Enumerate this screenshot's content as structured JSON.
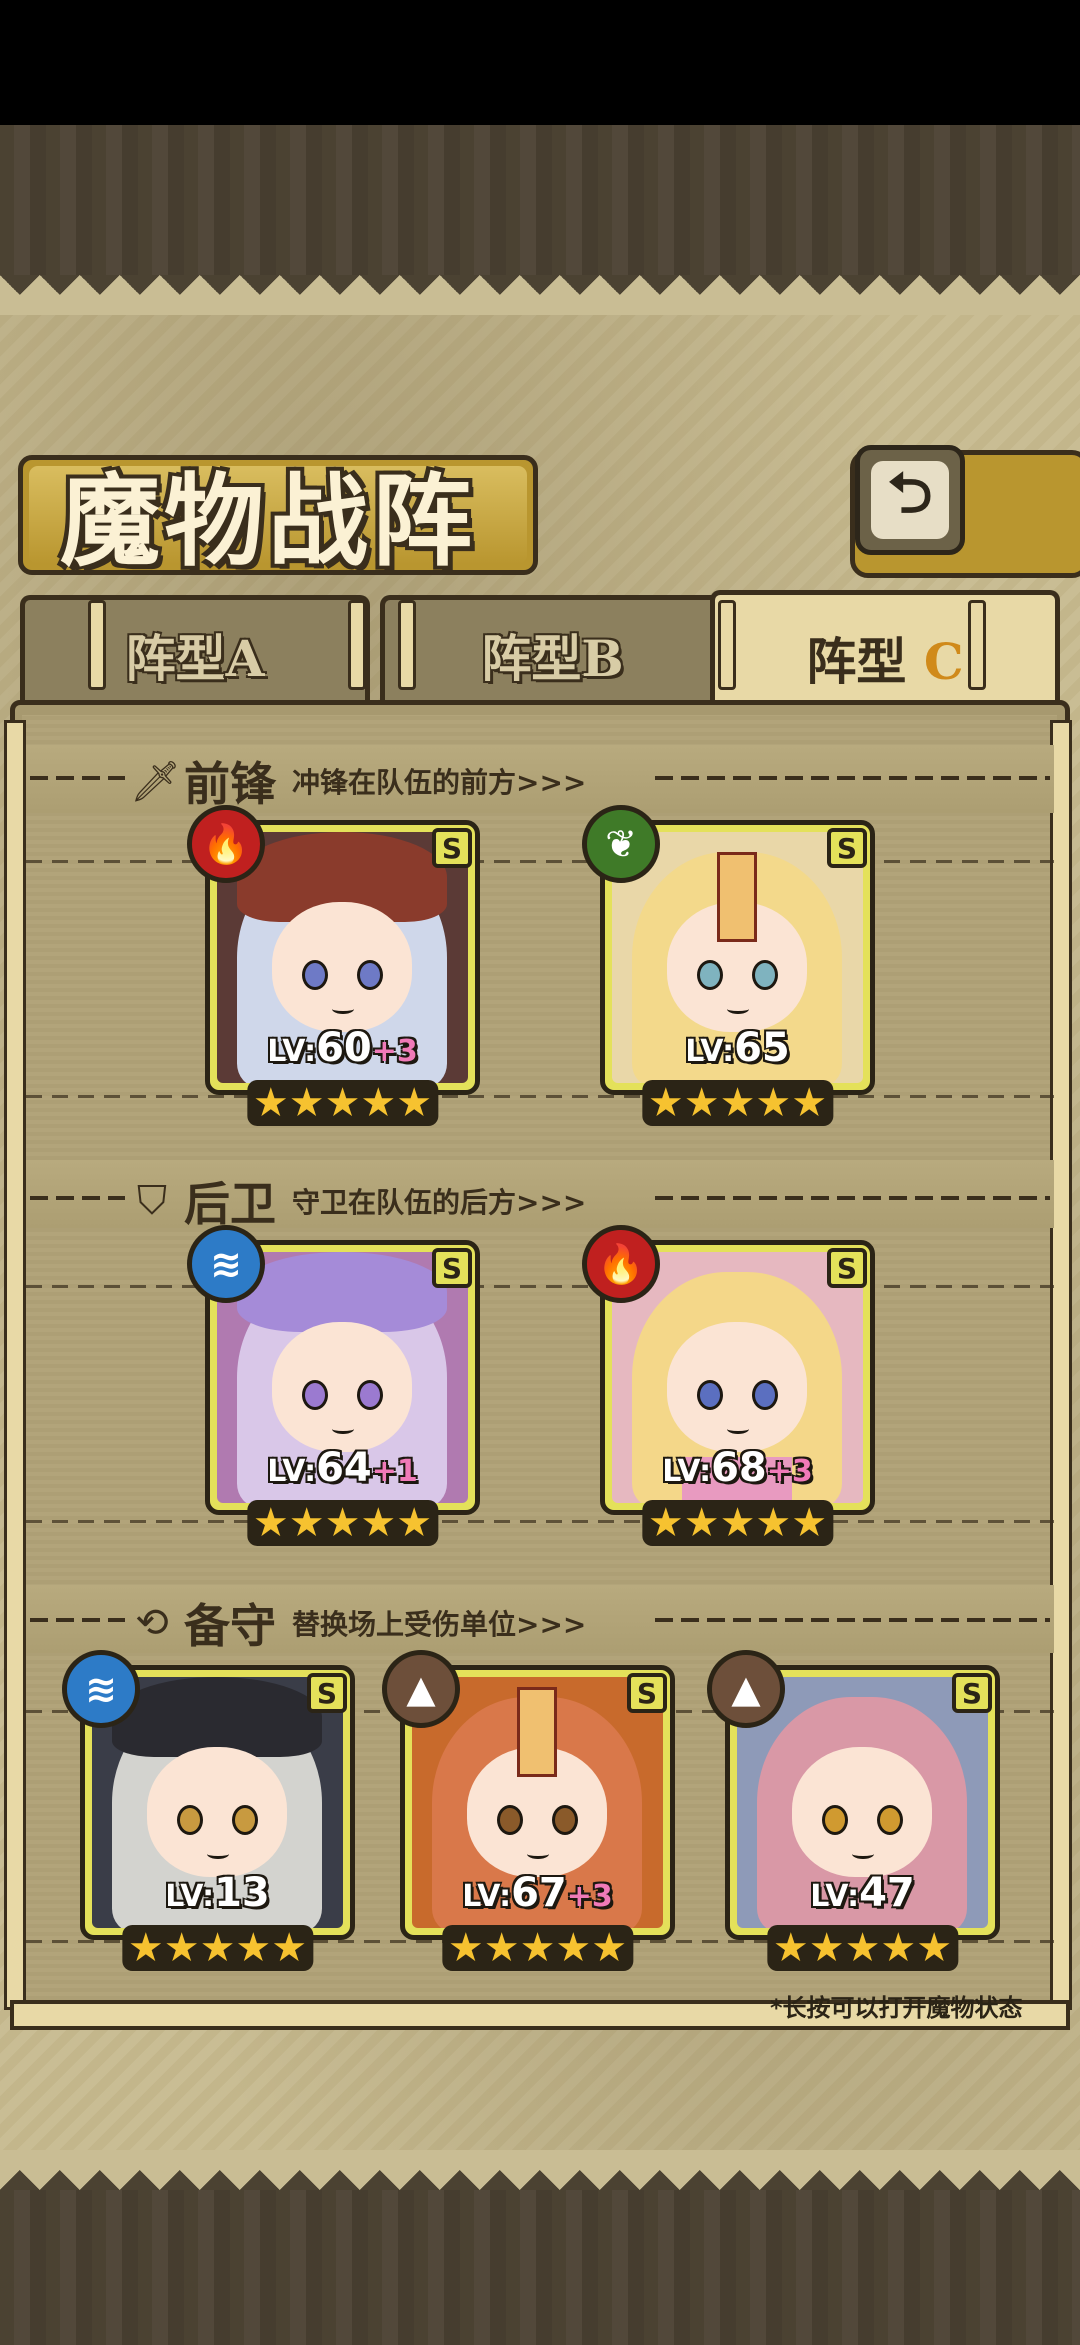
{
  "title": "魔物战阵",
  "back_icon": "back-arrow-icon",
  "tabs": [
    {
      "label": "阵型",
      "letter": "A",
      "active": false
    },
    {
      "label": "阵型",
      "letter": "B",
      "active": false
    },
    {
      "label": "阵型",
      "letter": "C",
      "active": true
    }
  ],
  "sections": {
    "front": {
      "icon": "sword-icon",
      "title": "前锋",
      "desc": "冲锋在队伍的前方>>>"
    },
    "back": {
      "icon": "shield-icon",
      "title": "后卫",
      "desc": "守卫在队伍的后方>>>"
    },
    "reserve": {
      "icon": "swap-icon",
      "title": "备守",
      "desc": "替换场上受伤单位>>>"
    }
  },
  "cards": {
    "front1": {
      "element": "fire",
      "rank": "S",
      "lv_prefix": "LV:",
      "level": "60",
      "plus": "+3",
      "stars": "★★★★★"
    },
    "front2": {
      "element": "grass",
      "rank": "S",
      "lv_prefix": "LV:",
      "level": "65",
      "plus": "",
      "stars": "★★★★★"
    },
    "back1": {
      "element": "water",
      "rank": "S",
      "lv_prefix": "LV:",
      "level": "64",
      "plus": "+1",
      "stars": "★★★★★"
    },
    "back2": {
      "element": "fire",
      "rank": "S",
      "lv_prefix": "LV:",
      "level": "68",
      "plus": "+3",
      "stars": "★★★★★"
    },
    "res1": {
      "element": "water",
      "rank": "S",
      "lv_prefix": "LV:",
      "level": "13",
      "plus": "",
      "stars": "★★★★★"
    },
    "res2": {
      "element": "earth",
      "rank": "S",
      "lv_prefix": "LV:",
      "level": "67",
      "plus": "+3",
      "stars": "★★★★★"
    },
    "res3": {
      "element": "earth",
      "rank": "S",
      "lv_prefix": "LV:",
      "level": "47",
      "plus": "",
      "stars": "★★★★★"
    }
  },
  "footnote": "*长按可以打开魔物状态",
  "colors": {
    "card_frame": "#e4e15a",
    "fire": "#c0201f",
    "grass": "#3f7a28",
    "water": "#2d7bc7",
    "earth": "#6d4f3a",
    "plus": "#f07ab8",
    "star": "#f6c230"
  }
}
